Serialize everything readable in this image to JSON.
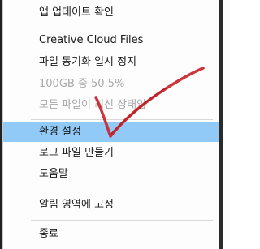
{
  "menu": {
    "items": [
      {
        "label": "앱 업데이트 확인",
        "disabled": false
      },
      {
        "label": "Creative Cloud Files",
        "disabled": false
      },
      {
        "label": "파일 동기화 일시 정지",
        "disabled": false
      },
      {
        "label": "100GB 중 50.5%",
        "disabled": true
      },
      {
        "label": "모든 파일이 최신 상태임",
        "disabled": true
      },
      {
        "label": "환경 설정",
        "disabled": false,
        "highlighted": true
      },
      {
        "label": "로그 파일 만들기",
        "disabled": false
      },
      {
        "label": "도움말",
        "disabled": false
      },
      {
        "label": "알림 영역에 고정",
        "disabled": false
      },
      {
        "label": "종료",
        "disabled": false
      }
    ]
  },
  "colors": {
    "highlight": "#91c9f7",
    "annotation": "#c9242b",
    "disabled_text": "#a9a9a9"
  }
}
